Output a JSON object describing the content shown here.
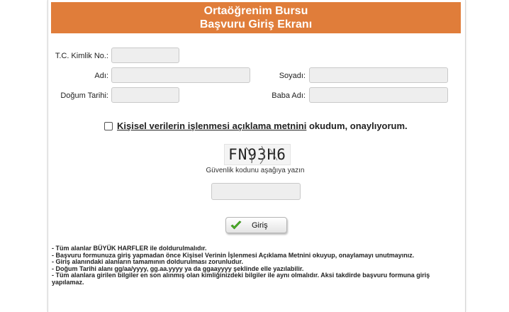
{
  "header": {
    "title_line1": "Ortaöğrenim Bursu",
    "title_line2": "Başvuru Giriş Ekranı"
  },
  "form": {
    "tc_label": "T.C. Kimlik No.:",
    "ad_label": "Adı:",
    "soyad_label": "Soyadı:",
    "dogum_label": "Doğum Tarihi:",
    "baba_label": "Baba Adı:"
  },
  "consent": {
    "link_text": "Kişisel verilerin işlenmesi açıklama metnini",
    "suffix_text": " okudum, onaylıyorum."
  },
  "captcha": {
    "code": "FN93H6",
    "hint": "Güvenlik kodunu aşağıya yazın"
  },
  "submit": {
    "label": "Giriş"
  },
  "notes": [
    "- Tüm alanlar BÜYÜK HARFLER ile doldurulmalıdır.",
    "- Başvuru formunuza giriş yapmadan önce Kişisel Verinin İşlenmesi Açıklama Metnini okuyup, onaylamayı unutmayınız.",
    "- Giriş alanındaki alanların tamamının doldurulması zorunludur.",
    "- Doğum Tarihi alanı gg/aa/yyyy, gg.aa.yyyy ya da ggaayyyy şeklinde elle yazılabilir.",
    "- Tüm alanlara girilen bilgiler en son alınmış olan kimliğinizdeki bilgiler ile aynı olmalıdır. Aksi takdirde başvuru formuna giriş yapılamaz."
  ],
  "colors": {
    "header_bg": "#e07d3a",
    "input_bg": "#eeeeee",
    "check_icon": "#4caf27"
  }
}
